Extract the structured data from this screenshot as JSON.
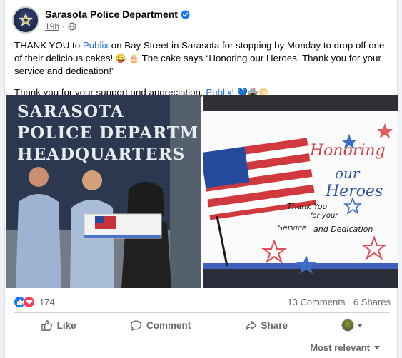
{
  "post": {
    "page_name": "Sarasota Police Department",
    "time": "19h",
    "avatar_icon": "police-badge-icon",
    "verified_icon": "verified-badge-icon",
    "privacy_icon": "globe-icon",
    "body": {
      "p1_before": "THANK YOU to ",
      "p1_link": "Publix",
      "p1_after": " on Bay Street in Sarasota for stopping by Monday to drop off one of their delicious cakes! ",
      "p1_emoji": "😜 🎂",
      "p1_after2": " The cake says “Honoring our Heroes. Thank you for your service and dedication!”",
      "p2_before": "Thank you for your support and appreciation, ",
      "p2_link": "Publix",
      "p2_after": "! ",
      "p2_emoji": "💙🚔🌕"
    },
    "photos": {
      "left_sign_lines": [
        "SARASOTA",
        "POLICE DEPARTM",
        "HEADQUARTERS"
      ],
      "cake_text_lines": [
        "Honoring",
        "our",
        "Heroes",
        "Thank You",
        "for your",
        "Service",
        "and Dedication"
      ]
    },
    "stats": {
      "reaction_count": "174",
      "comments": "13 Comments",
      "shares": "6 Shares",
      "reaction_icons": [
        "like-icon",
        "love-icon"
      ]
    },
    "actions": {
      "like": "Like",
      "comment": "Comment",
      "share": "Share"
    },
    "sort": {
      "label": "Most relevant"
    },
    "colors": {
      "link": "#216fdb",
      "like_blue": "#1877f2",
      "love_red": "#f33e58",
      "secondary_text": "#65676b"
    }
  }
}
